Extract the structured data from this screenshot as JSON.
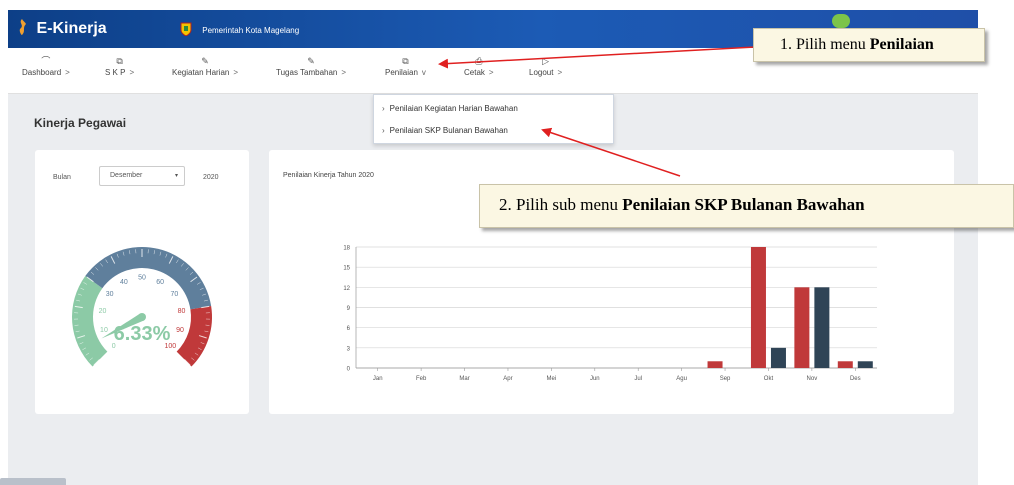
{
  "app": {
    "title": "E-Kinerja",
    "org_name": "Pemerintah Kota Magelang"
  },
  "menu": [
    {
      "label": "Dashboard",
      "icon": "dashboard-icon",
      "chevron": ">"
    },
    {
      "label": "S K P",
      "icon": "copy-icon",
      "chevron": ">"
    },
    {
      "label": "Kegiatan Harian",
      "icon": "edit-icon",
      "chevron": ">"
    },
    {
      "label": "Tugas Tambahan",
      "icon": "edit-icon",
      "chevron": ">"
    },
    {
      "label": "Penilaian",
      "icon": "copy-icon",
      "chevron": "v"
    },
    {
      "label": "Cetak",
      "icon": "print-icon",
      "chevron": ">"
    },
    {
      "label": "Logout",
      "icon": "logout-icon",
      "chevron": ">"
    }
  ],
  "dropdown": {
    "items": [
      {
        "label": "Penilaian Kegiatan Harian Bawahan"
      },
      {
        "label": "Penilaian SKP Bulanan Bawahan"
      }
    ]
  },
  "page": {
    "title": "Kinerja Pegawai"
  },
  "gauge_card": {
    "month_label": "Bulan",
    "month_value": "Desember",
    "year": "2020",
    "value_text": "6.33%",
    "value": 6.33,
    "ticks": [
      "0",
      "10",
      "20",
      "30",
      "40",
      "50",
      "60",
      "70",
      "80",
      "90",
      "100"
    ],
    "colors": {
      "low": "#8ccaa6",
      "mid": "#5f7f9c",
      "high": "#c0393a"
    }
  },
  "chart_card": {
    "title": "Penilaian Kinerja Tahun 2020"
  },
  "chart_data": {
    "type": "bar",
    "title": "Penilaian Kinerja Tahun 2020",
    "categories": [
      "Jan",
      "Feb",
      "Mar",
      "Apr",
      "Mei",
      "Jun",
      "Jul",
      "Agu",
      "Sep",
      "Okt",
      "Nov",
      "Des"
    ],
    "series": [
      {
        "color": "#c0393a",
        "values": [
          0,
          0,
          0,
          0,
          0,
          0,
          0,
          0,
          1,
          18,
          12,
          1
        ]
      },
      {
        "color": "#2f4456",
        "values": [
          0,
          0,
          0,
          0,
          0,
          0,
          0,
          0,
          0,
          3,
          12,
          1
        ]
      }
    ],
    "y_ticks": [
      "0",
      "3",
      "6",
      "9",
      "12",
      "15",
      "18"
    ],
    "ylim": [
      0,
      18
    ],
    "grid": true
  },
  "annotations": {
    "step1_prefix": "1. Pilih menu ",
    "step1_bold": "Penilaian",
    "step2_prefix": "2. Pilih sub menu ",
    "step2_bold": "Penilaian SKP Bulanan Bawahan",
    "arrow_color": "#e02020"
  }
}
